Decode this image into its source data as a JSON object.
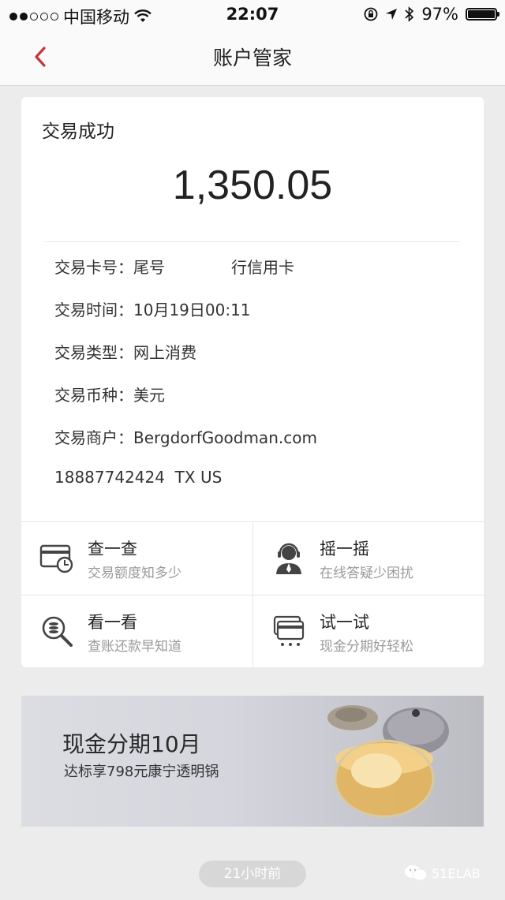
{
  "status_bar": {
    "carrier": "中国移动",
    "time": "22:07",
    "battery": "97%"
  },
  "nav": {
    "title": "账户管家"
  },
  "transaction": {
    "status": "交易成功",
    "amount": "1,350.05",
    "card_label": "交易卡号：",
    "card_prefix": "尾号",
    "card_suffix": "行信用卡",
    "time_label": "交易时间：",
    "time_value": "10月19日00:11",
    "type_label": "交易类型：",
    "type_value": "网上消费",
    "currency_label": "交易币种：",
    "currency_value": "美元",
    "merchant_label": "交易商户：",
    "merchant_value": "BergdorfGoodman.com",
    "merchant_extra": "18887742424  TX US"
  },
  "services": [
    {
      "title": "查一查",
      "subtitle": "交易额度知多少",
      "icon": "card-clock-icon"
    },
    {
      "title": "摇一摇",
      "subtitle": "在线答疑少困扰",
      "icon": "customer-service-icon"
    },
    {
      "title": "看一看",
      "subtitle": "查账还款早知道",
      "icon": "magnifier-coins-icon"
    },
    {
      "title": "试一试",
      "subtitle": "现金分期好轻松",
      "icon": "cards-stack-icon"
    }
  ],
  "banner": {
    "headline": "现金分期10月",
    "subline": "达标享798元康宁透明锅"
  },
  "footer": {
    "timestamp": "21小时前",
    "watermark": "51ELAB"
  },
  "colors": {
    "accent": "#c0363d",
    "page_bg": "#ececec",
    "card_bg": "#ffffff"
  }
}
